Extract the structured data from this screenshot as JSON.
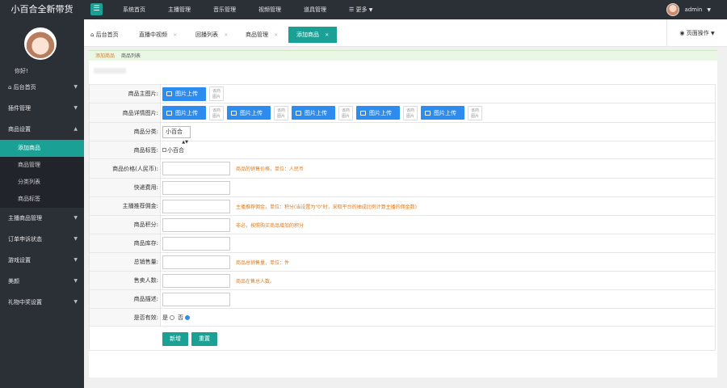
{
  "app": {
    "brand": "小百合全新带货"
  },
  "topnav": {
    "menu_icon": "menu-icon",
    "items": [
      "系统首页",
      "主播管理",
      "音乐管理",
      "视频管理",
      "道具管理"
    ],
    "more_label": "更多",
    "user_name": "admin"
  },
  "sidebar": {
    "greeting": "你好!",
    "items": [
      {
        "label": "后台首页"
      },
      {
        "label": "插件管理"
      },
      {
        "label": "商品设置"
      }
    ],
    "sub_items": [
      {
        "label": "添加商品"
      },
      {
        "label": "商品管理"
      },
      {
        "label": "分类列表"
      },
      {
        "label": "商品标签"
      }
    ],
    "items_after": [
      {
        "label": "主播商品管理"
      },
      {
        "label": "订单申诉状态"
      },
      {
        "label": "游戏设置"
      },
      {
        "label": "美颜"
      },
      {
        "label": "礼物中奖设置"
      }
    ]
  },
  "tabs": {
    "items": [
      "后台首页",
      "直播中视频",
      "回播列表",
      "商品管理",
      "添加商品"
    ],
    "page_ops": "页面操作"
  },
  "breadcrumb": {
    "current_link": "添加商品",
    "next": "商品列表"
  },
  "form": {
    "main_image_label": "商品主图片:",
    "upload_label": "图片上传",
    "placeholder_img": "该商\n图片",
    "detail_images_label": "商品详情图片:",
    "category_label": "商品分类:",
    "category_value": "小百合",
    "tag_label": "商品标签:",
    "tag_option": "小百合",
    "price_label": "商品价格(人民币):",
    "price_hint": "商品的销售价格，单位：人民币",
    "shipping_label": "快递费用:",
    "commission_label": "主播推荐佣金:",
    "commission_hint": "主播推荐佣金，单位：积分(当设置为\"0\"时，采取平台的抽成比例计算主播的佣金数)",
    "points_label": "商品积分:",
    "points_hint": "非必，按照购买商品增加的积分",
    "stock_label": "商品库存:",
    "sold_label": "总销售量:",
    "sold_hint": "商品总销售量，单位：件",
    "buyers_label": "售卖人数:",
    "buyers_hint": "商品在售总人数。",
    "desc_label": "商品描述:",
    "valid_label": "是否有效:",
    "valid_yes": "是",
    "valid_no": "否",
    "submit_label": "新增",
    "reset_label": "重置"
  }
}
